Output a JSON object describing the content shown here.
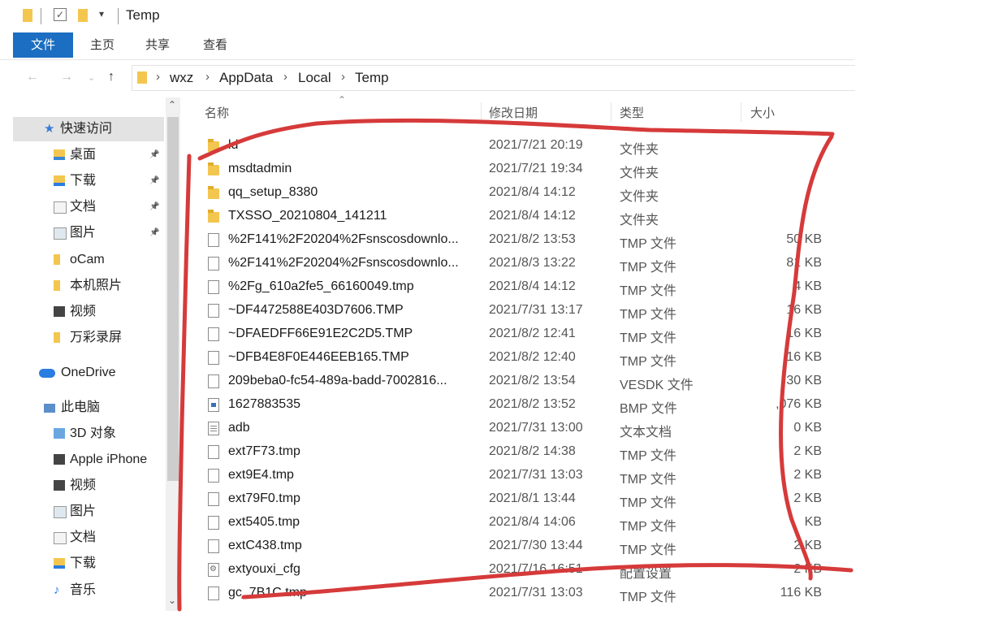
{
  "window": {
    "title": "Temp"
  },
  "ribbon": {
    "tabs": [
      "文件",
      "主页",
      "共享",
      "查看"
    ]
  },
  "address": {
    "crumbs": [
      "wxz",
      "AppData",
      "Local",
      "Temp"
    ]
  },
  "nav": {
    "items": [
      {
        "label": "快速访问",
        "icon": "star-icon",
        "pinned": false
      },
      {
        "label": "桌面",
        "icon": "desktop-folder-icon",
        "pinned": true
      },
      {
        "label": "下载",
        "icon": "download-folder-icon",
        "pinned": true
      },
      {
        "label": "文档",
        "icon": "documents-folder-icon",
        "pinned": true
      },
      {
        "label": "图片",
        "icon": "pictures-folder-icon",
        "pinned": true
      },
      {
        "label": "oCam",
        "icon": "folder-icon",
        "pinned": false
      },
      {
        "label": "本机照片",
        "icon": "folder-icon",
        "pinned": false
      },
      {
        "label": "视频",
        "icon": "videos-folder-icon",
        "pinned": false
      },
      {
        "label": "万彩录屏",
        "icon": "folder-icon",
        "pinned": false
      },
      {
        "label": "OneDrive",
        "icon": "cloud-icon",
        "pinned": false
      },
      {
        "label": "此电脑",
        "icon": "computer-icon",
        "pinned": false
      },
      {
        "label": "3D 对象",
        "icon": "3d-objects-icon",
        "pinned": false
      },
      {
        "label": "Apple iPhone",
        "icon": "phone-icon",
        "pinned": false
      },
      {
        "label": "视频",
        "icon": "videos-folder-icon",
        "pinned": false
      },
      {
        "label": "图片",
        "icon": "pictures-folder-icon",
        "pinned": false
      },
      {
        "label": "文档",
        "icon": "documents-folder-icon",
        "pinned": false
      },
      {
        "label": "下载",
        "icon": "download-folder-icon",
        "pinned": false
      },
      {
        "label": "音乐",
        "icon": "music-folder-icon",
        "pinned": false
      }
    ]
  },
  "columns": {
    "name": "名称",
    "date": "修改日期",
    "type": "类型",
    "size": "大小"
  },
  "files": [
    {
      "name": "ld",
      "date": "2021/7/21 20:19",
      "type": "文件夹",
      "size": "",
      "icon": "folder-icon"
    },
    {
      "name": "msdtadmin",
      "date": "2021/7/21 19:34",
      "type": "文件夹",
      "size": "",
      "icon": "folder-icon"
    },
    {
      "name": "qq_setup_8380",
      "date": "2021/8/4 14:12",
      "type": "文件夹",
      "size": "",
      "icon": "folder-icon"
    },
    {
      "name": "TXSSO_20210804_141211",
      "date": "2021/8/4 14:12",
      "type": "文件夹",
      "size": "",
      "icon": "folder-icon"
    },
    {
      "name": "%2F141%2F20204%2Fsnscosdownlo...",
      "date": "2021/8/2 13:53",
      "type": "TMP 文件",
      "size": "50 KB",
      "icon": "file-icon"
    },
    {
      "name": "%2F141%2F20204%2Fsnscosdownlo...",
      "date": "2021/8/3 13:22",
      "type": "TMP 文件",
      "size": "81 KB",
      "icon": "file-icon"
    },
    {
      "name": "%2Fg_610a2fe5_66160049.tmp",
      "date": "2021/8/4 14:12",
      "type": "TMP 文件",
      "size": "4 KB",
      "icon": "file-icon"
    },
    {
      "name": "~DF4472588E403D7606.TMP",
      "date": "2021/7/31 13:17",
      "type": "TMP 文件",
      "size": "16 KB",
      "icon": "file-icon"
    },
    {
      "name": "~DFAEDFF66E91E2C2D5.TMP",
      "date": "2021/8/2 12:41",
      "type": "TMP 文件",
      "size": "16 KB",
      "icon": "file-icon"
    },
    {
      "name": "~DFB4E8F0E446EEB165.TMP",
      "date": "2021/8/2 12:40",
      "type": "TMP 文件",
      "size": "16 KB",
      "icon": "file-icon"
    },
    {
      "name": "209beba0-fc54-489a-badd-7002816...",
      "date": "2021/8/2 13:54",
      "type": "VESDK 文件",
      "size": "30 KB",
      "icon": "file-icon"
    },
    {
      "name": "1627883535",
      "date": "2021/8/2 13:52",
      "type": "BMP 文件",
      "size": ",076 KB",
      "icon": "bitmap-file-icon"
    },
    {
      "name": "adb",
      "date": "2021/7/31 13:00",
      "type": "文本文档",
      "size": "0 KB",
      "icon": "text-file-icon"
    },
    {
      "name": "ext7F73.tmp",
      "date": "2021/8/2 14:38",
      "type": "TMP 文件",
      "size": "2 KB",
      "icon": "file-icon"
    },
    {
      "name": "ext9E4.tmp",
      "date": "2021/7/31 13:03",
      "type": "TMP 文件",
      "size": "2 KB",
      "icon": "file-icon"
    },
    {
      "name": "ext79F0.tmp",
      "date": "2021/8/1 13:44",
      "type": "TMP 文件",
      "size": "2 KB",
      "icon": "file-icon"
    },
    {
      "name": "ext5405.tmp",
      "date": "2021/8/4 14:06",
      "type": "TMP 文件",
      "size": "KB",
      "icon": "file-icon"
    },
    {
      "name": "extC438.tmp",
      "date": "2021/7/30 13:44",
      "type": "TMP 文件",
      "size": "2 KB",
      "icon": "file-icon"
    },
    {
      "name": "extyouxi_cfg",
      "date": "2021/7/16 16:51",
      "type": "配置设置",
      "size": "2 KB",
      "icon": "config-file-icon"
    },
    {
      "name": "gc_7B1C.tmp",
      "date": "2021/7/31 13:03",
      "type": "TMP 文件",
      "size": "116 KB",
      "icon": "file-icon"
    }
  ],
  "colors": {
    "accent": "#1b6ec2",
    "folder": "#f3c64f",
    "marker": "#d63a3a"
  }
}
